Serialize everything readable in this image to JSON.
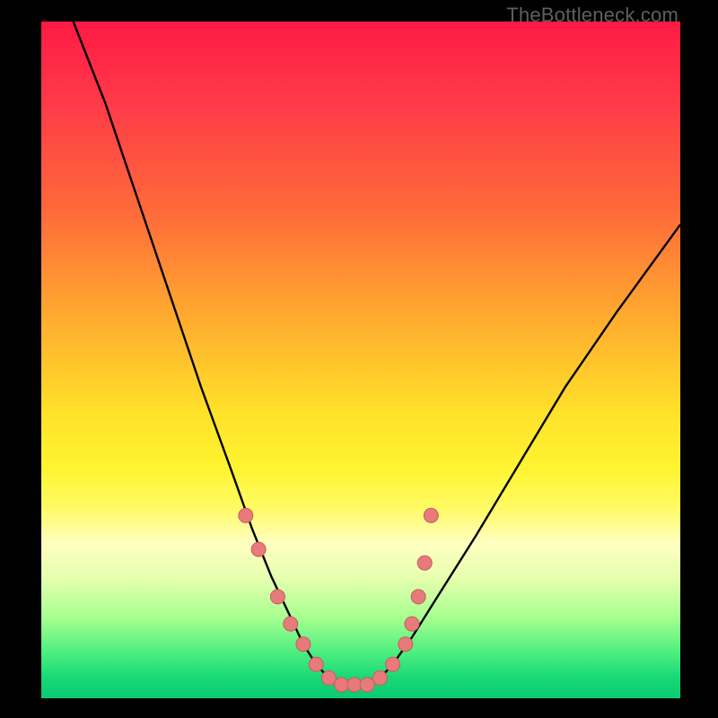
{
  "watermark": "TheBottleneck.com",
  "colors": {
    "background": "#000000",
    "curve_stroke": "#000000",
    "marker_fill": "#e77a7a",
    "marker_stroke": "#c95c5c"
  },
  "chart_data": {
    "type": "line",
    "title": "",
    "xlabel": "",
    "ylabel": "",
    "xlim": [
      0,
      100
    ],
    "ylim": [
      0,
      100
    ],
    "series": [
      {
        "name": "bottleneck-curve",
        "x": [
          5,
          10,
          15,
          20,
          25,
          30,
          33,
          36,
          39,
          41,
          43,
          45,
          47,
          49,
          51,
          53,
          55,
          58,
          62,
          68,
          75,
          82,
          90,
          100
        ],
        "y": [
          100,
          88,
          74,
          60,
          46,
          33,
          25,
          18,
          12,
          8,
          5,
          3,
          2,
          2,
          2,
          3,
          5,
          9,
          15,
          24,
          35,
          46,
          57,
          70
        ]
      }
    ],
    "markers": {
      "name": "highlight-points",
      "x": [
        32,
        34,
        37,
        39,
        41,
        43,
        45,
        47,
        49,
        51,
        53,
        55,
        57,
        58,
        59,
        60,
        61
      ],
      "y": [
        27,
        22,
        15,
        11,
        8,
        5,
        3,
        2,
        2,
        2,
        3,
        5,
        8,
        11,
        15,
        20,
        27
      ]
    }
  }
}
